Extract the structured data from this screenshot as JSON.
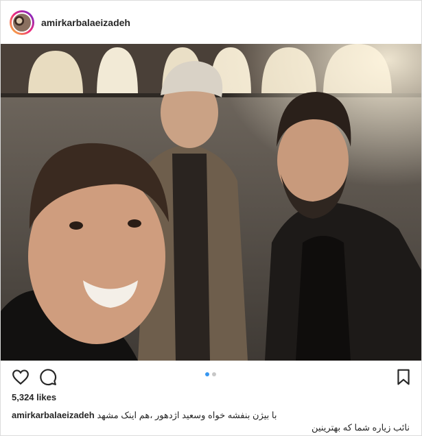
{
  "post": {
    "username": "amirkarbalaeizadeh",
    "avatar_icon": "profile-avatar",
    "likes": "5,324 likes",
    "caption_user": "amirkarbalaeizadeh",
    "caption_line1": "با بیژن بنفشه خواه وسعید اژدهور ،هم اینک مشهد",
    "caption_line2": "نائب زیاره شما که بهترینین",
    "carousel": {
      "total": 2,
      "active": 1
    }
  },
  "actions": {
    "like_icon": "heart-outline-icon",
    "comment_icon": "comment-bubble-icon",
    "save_icon": "bookmark-outline-icon"
  },
  "colors": {
    "accent": "#3897f0",
    "text": "#262626",
    "border": "#dbdbdb"
  }
}
